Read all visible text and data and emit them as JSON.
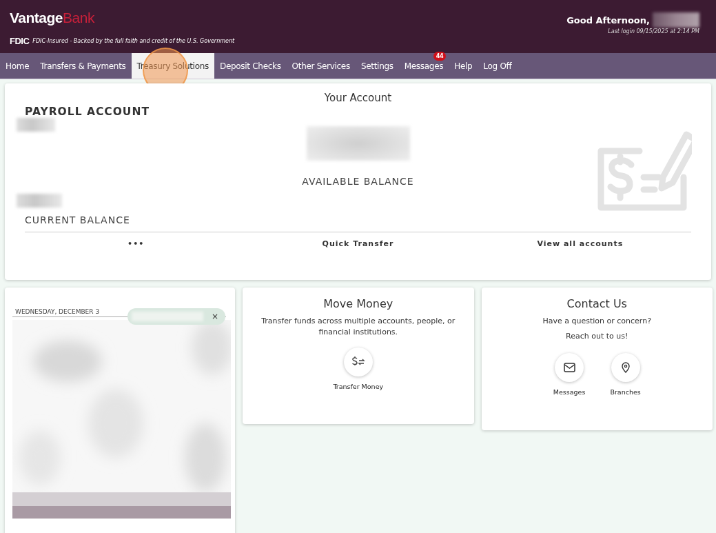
{
  "header": {
    "logo": {
      "brand": "Vantage",
      "suffix": "Bank"
    },
    "fdic": {
      "mark": "FDIC",
      "tagline": "FDIC-Insured - Backed by the full faith and credit of the U.S. Government"
    },
    "greeting": "Good Afternoon,",
    "last_login": "Last login 09/15/2025 at 2:14 PM"
  },
  "nav": [
    {
      "label": "Home",
      "selected": false
    },
    {
      "label": "Transfers & Payments",
      "selected": false
    },
    {
      "label": "Treasury Solutions",
      "selected": true
    },
    {
      "label": "Deposit Checks",
      "selected": false
    },
    {
      "label": "Other Services",
      "selected": false
    },
    {
      "label": "Settings",
      "selected": false
    },
    {
      "label": "Messages",
      "selected": false,
      "badge": "44"
    },
    {
      "label": "Help",
      "selected": false
    },
    {
      "label": "Log Off",
      "selected": false
    }
  ],
  "account": {
    "title": "Your Account",
    "name": "PAYROLL ACCOUNT",
    "available_label": "AVAILABLE BALANCE",
    "current_label": "CURRENT BALANCE",
    "actions": [
      {
        "label": "•••"
      },
      {
        "label": "Quick Transfer"
      },
      {
        "label": "View all accounts"
      }
    ]
  },
  "calendar": {
    "date": "WEDNESDAY, DECEMBER 3",
    "chip_close": "×"
  },
  "move_money": {
    "title": "Move Money",
    "text": "Transfer funds across multiple accounts, people, or financial institutions.",
    "actions": [
      {
        "label": "Transfer Money",
        "kind": "transfer"
      }
    ]
  },
  "contact": {
    "title": "Contact Us",
    "question": "Have a question or concern?",
    "text": "Reach out to us!",
    "actions": [
      {
        "label": "Messages",
        "kind": "mail"
      },
      {
        "label": "Branches",
        "kind": "pin"
      }
    ]
  }
}
